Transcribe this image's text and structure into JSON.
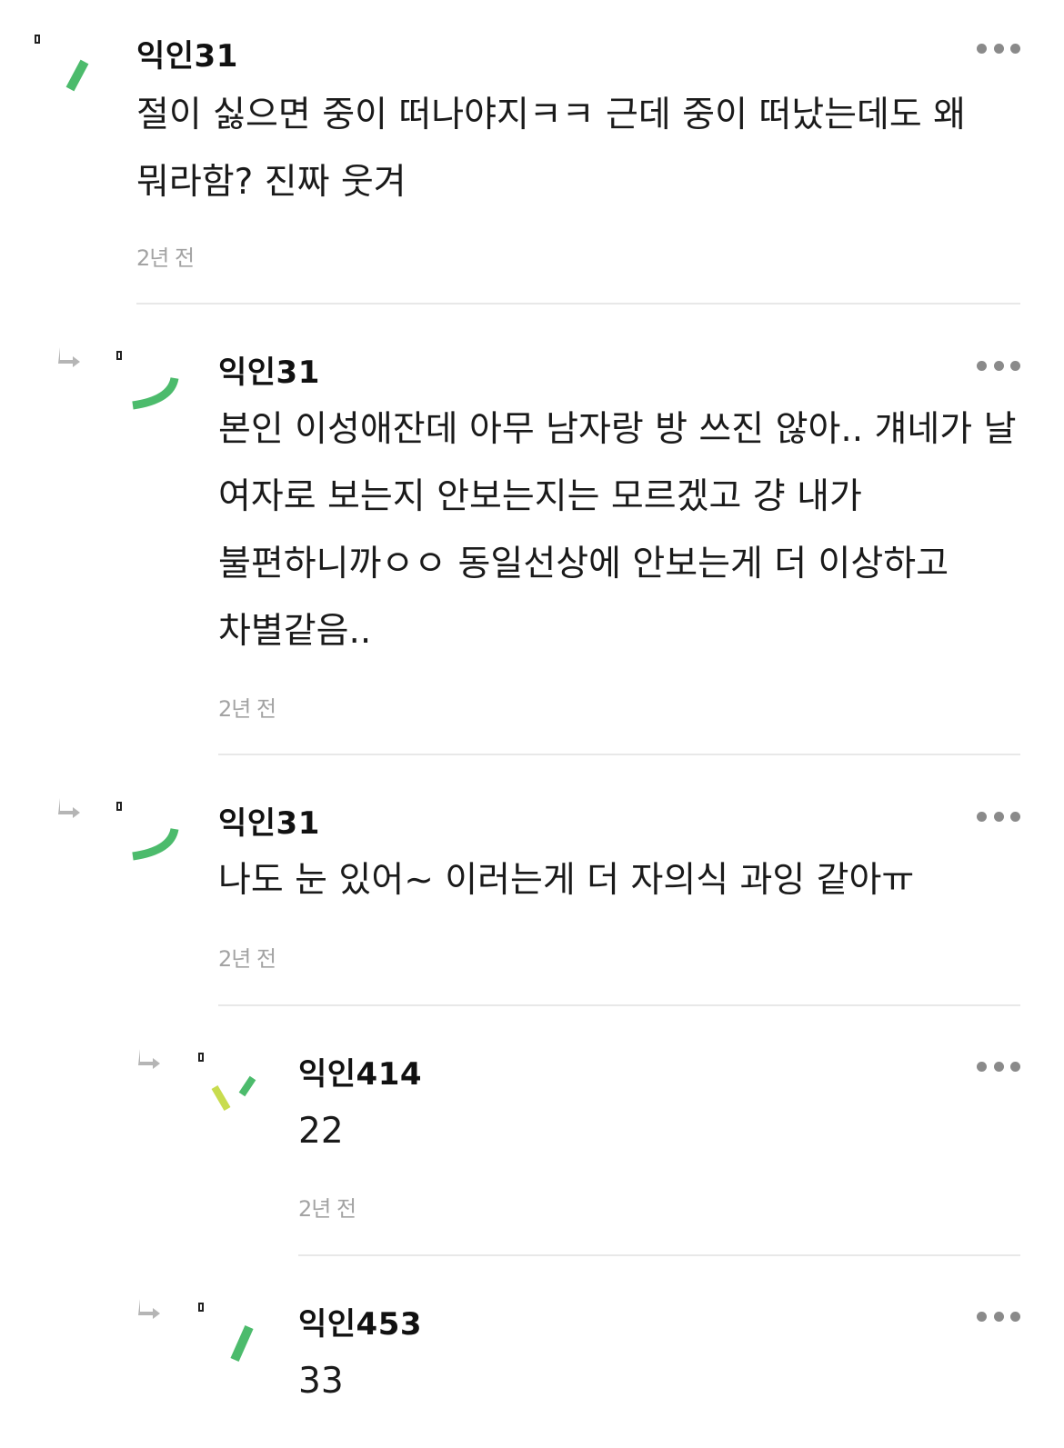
{
  "comments": [
    {
      "author": "익인31",
      "text": "절이 싫으면 중이 떠나야지ㅋㅋ 근데 중이 떠났는데도 왜 뭐라함? 진짜 웃겨",
      "time": "2년 전",
      "is_reply": false
    },
    {
      "author": "익인31",
      "text": "본인 이성애잔데 아무 남자랑 방 쓰진 않아.. 걔네가 날 여자로 보는지 안보는지는 모르겠고 걍 내가 불편하니까ㅇㅇ 동일선상에 안보는게 더 이상하고 차별같음..",
      "time": "2년 전",
      "is_reply": true
    },
    {
      "author": "익인31",
      "text": "나도 눈 있어~ 이러는게 더 자의식 과잉 같아ㅠ",
      "time": "2년 전",
      "is_reply": true
    },
    {
      "author": "익인414",
      "text": "22",
      "time": "2년 전",
      "is_reply": true
    },
    {
      "author": "익인453",
      "text": "33",
      "is_reply": true
    }
  ],
  "colors": {
    "avatar_green": "#4cbb6c",
    "avatar_lime": "#c8dc4e",
    "timestamp_gray": "#a3a3a3",
    "more_dots": "#8a8a8a",
    "reply_arrow": "#b5b5b5"
  },
  "icons": {
    "reply": "reply-arrow-icon",
    "more": "more-dots-icon",
    "image": "broken-image-icon"
  }
}
